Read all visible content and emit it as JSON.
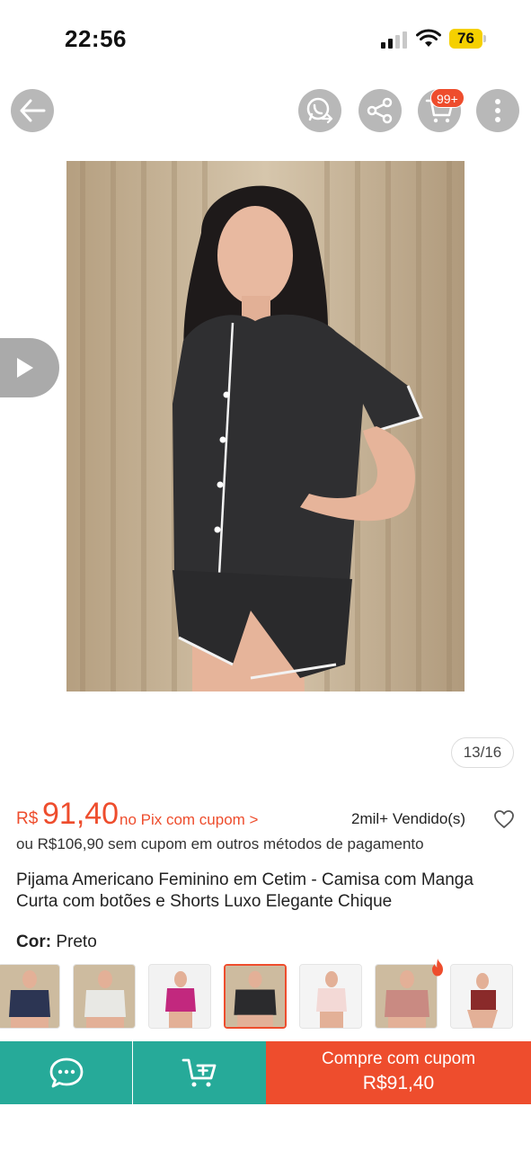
{
  "status_bar": {
    "time": "22:56",
    "battery_level": "76",
    "battery_color": "#f5d000"
  },
  "header": {
    "cart_badge": "99+",
    "icons": [
      "back-arrow-icon",
      "whatsapp-share-icon",
      "share-icon",
      "cart-icon",
      "more-vertical-icon"
    ]
  },
  "gallery": {
    "counter": "13/16",
    "video_icon": "play-icon"
  },
  "price": {
    "currency": "R$",
    "value": "91,40",
    "note": "no Pix com cupom >",
    "sold": "2mil+ Vendido(s)",
    "alt_price": "ou R$106,90 sem cupom em outros métodos de pagamento"
  },
  "product": {
    "title": "Pijama Americano Feminino em Cetim - Camisa com Manga Curta com botões e Shorts Luxo Elegante Chique",
    "color_label": "Cor:",
    "color_value": "Preto"
  },
  "variants": [
    {
      "color": "#2c3553",
      "selected": false
    },
    {
      "color": "#e8e8e4",
      "selected": false
    },
    {
      "color": "#c2287e",
      "selected": false
    },
    {
      "color": "#2b2b2d",
      "selected": true
    },
    {
      "color": "#f3d9d6",
      "selected": false
    },
    {
      "color": "#c98a82",
      "selected": false,
      "hot": true
    },
    {
      "color": "#8a2a2a",
      "selected": false
    }
  ],
  "bottom_bar": {
    "buy_label": "Compre com cupom",
    "buy_price": "R$91,40",
    "icons": [
      "chat-icon",
      "add-to-cart-icon"
    ]
  },
  "colors": {
    "accent": "#ee4d2d",
    "teal": "#26aa99",
    "nav_circle": "#b8b8b8"
  }
}
